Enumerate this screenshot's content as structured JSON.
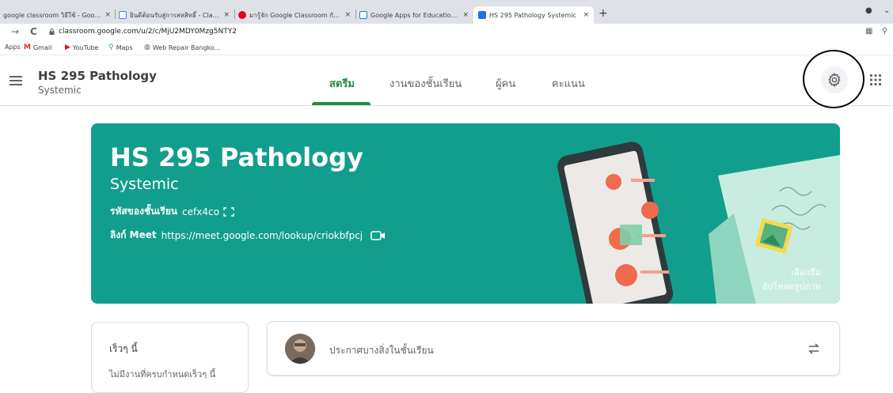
{
  "browser": {
    "tabs": [
      {
        "title": "google classroom วิธีใช้ - Google",
        "close": "×"
      },
      {
        "title": "ยินดีต้อนรับสู่การสหสิทธิ์ - Classroom",
        "close": "×"
      },
      {
        "title": "มารู้จัก Google Classroom กันเถอะ",
        "close": "×"
      },
      {
        "title": "Google Apps for Education คืออะไร",
        "close": "×"
      },
      {
        "title": "HS 295 Pathology Systemic",
        "close": "×"
      }
    ],
    "new_tab": "+",
    "url": "classroom.google.com/u/2/c/MjU2MDY0Mzg5NTY2",
    "back": "→",
    "reload": "C",
    "bookmarks": [
      {
        "label": "Apps",
        "icon": "apps-grid-icon"
      },
      {
        "label": "Gmail",
        "icon": "gmail-icon"
      },
      {
        "label": "YouTube",
        "icon": "youtube-icon"
      },
      {
        "label": "Maps",
        "icon": "maps-icon"
      },
      {
        "label": "Web Repair Bangko...",
        "icon": "globe-icon"
      }
    ]
  },
  "header": {
    "class_title": "HS 295 Pathology",
    "class_subtitle": "Systemic",
    "tabs": [
      {
        "label": "สตรีม",
        "active": true
      },
      {
        "label": "งานของชั้นเรียน",
        "active": false
      },
      {
        "label": "ผู้คน",
        "active": false
      },
      {
        "label": "คะแนน",
        "active": false
      }
    ],
    "accent": "#1e8e3e"
  },
  "banner": {
    "title": "HS 295 Pathology",
    "subtitle": "Systemic",
    "code_label": "รหัสของชั้นเรียน",
    "code_value": "cefx4co",
    "meet_label": "ลิงก์ Meet",
    "meet_value": "https://meet.google.com/lookup/criokbfpcj",
    "select_theme": "เลือกธีม",
    "upload_photo": "อัปโหลดรูปภาพ",
    "color": "#129e8c"
  },
  "upcoming": {
    "title": "เร็วๆ นี้",
    "empty": "ไม่มีงานที่ครบกำหนดเร็วๆ นี้"
  },
  "announce": {
    "placeholder": "ประกาศบางสิ่งในชั้นเรียน"
  }
}
